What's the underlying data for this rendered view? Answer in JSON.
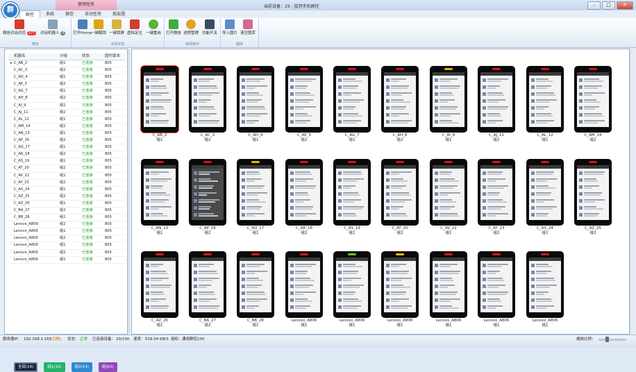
{
  "window": {
    "title": "当前设备：29 - 蓝邦手机群控",
    "context_tab": "营销任务",
    "tabs": [
      "群控",
      "系统",
      "微信",
      "自动任务",
      "朋友圈"
    ],
    "logo_glyph": "群"
  },
  "ribbon": {
    "groups": [
      {
        "label": "微信",
        "buttons": [
          {
            "label": "微信对话总控",
            "badge": "177"
          },
          {
            "label": "对话机器人",
            "badge": "0"
          }
        ]
      },
      {
        "label": "手机状态",
        "buttons": [
          {
            "label": "打开Home"
          },
          {
            "label": "一键解锁"
          },
          {
            "label": "一键锁屏"
          },
          {
            "label": "虚拟定位"
          },
          {
            "label": "一键重启"
          }
        ]
      },
      {
        "label": "常规操作",
        "buttons": [
          {
            "label": "打开微信"
          },
          {
            "label": "进程管理"
          },
          {
            "label": "功能开关"
          }
        ]
      },
      {
        "label": "图库",
        "buttons": [
          {
            "label": "导入图片"
          },
          {
            "label": "清空图库"
          }
        ]
      }
    ]
  },
  "device_table": {
    "headers": [
      "机器名",
      "分组",
      "状态",
      "固件版本"
    ],
    "rows": [
      {
        "name": "C_AB_2",
        "group": "组1",
        "status": "已连接",
        "fw": "805"
      },
      {
        "name": "C_AC_3",
        "group": "组2",
        "status": "已连接",
        "fw": "805"
      },
      {
        "name": "C_AD_4",
        "group": "组1",
        "status": "已连接",
        "fw": "805"
      },
      {
        "name": "C_AE_5",
        "group": "组2",
        "status": "已连接",
        "fw": "805"
      },
      {
        "name": "C_AG_7",
        "group": "组1",
        "status": "已连接",
        "fw": "805"
      },
      {
        "name": "C_AH_8",
        "group": "组2",
        "status": "已连接",
        "fw": "805"
      },
      {
        "name": "C_AI_9",
        "group": "组1",
        "status": "已连接",
        "fw": "805"
      },
      {
        "name": "C_AJ_11",
        "group": "组2",
        "status": "已连接",
        "fw": "805"
      },
      {
        "name": "C_AL_12",
        "group": "组1",
        "status": "已连接",
        "fw": "805"
      },
      {
        "name": "C_AM_14",
        "group": "组2",
        "status": "已连接",
        "fw": "805"
      },
      {
        "name": "C_AN_13",
        "group": "组1",
        "status": "已连接",
        "fw": "805"
      },
      {
        "name": "C_AP_16",
        "group": "组2",
        "status": "已连接",
        "fw": "805"
      },
      {
        "name": "C_AQ_17",
        "group": "组1",
        "status": "已连接",
        "fw": "805"
      },
      {
        "name": "C_AR_18",
        "group": "组2",
        "status": "已连接",
        "fw": "805"
      },
      {
        "name": "C_AS_19",
        "group": "组1",
        "status": "已连接",
        "fw": "805"
      },
      {
        "name": "C_AT_20",
        "group": "组2",
        "status": "已连接",
        "fw": "805"
      },
      {
        "name": "C_AV_22",
        "group": "组1",
        "status": "已连接",
        "fw": "805"
      },
      {
        "name": "C_AY_23",
        "group": "组2",
        "status": "已连接",
        "fw": "805"
      },
      {
        "name": "C_AX_24",
        "group": "组1",
        "status": "已连接",
        "fw": "805"
      },
      {
        "name": "C_AZ_25",
        "group": "组2",
        "status": "已连接",
        "fw": "805"
      },
      {
        "name": "C_AZ_26",
        "group": "组1",
        "status": "已连接",
        "fw": "805"
      },
      {
        "name": "C_BA_27",
        "group": "组2",
        "status": "已连接",
        "fw": "805"
      },
      {
        "name": "C_BB_28",
        "group": "组1",
        "status": "已连接",
        "fw": "805"
      },
      {
        "name": "Lenovo_A806",
        "group": "组2",
        "status": "已连接",
        "fw": "805"
      },
      {
        "name": "Lenovo_A806",
        "group": "组1",
        "status": "已连接",
        "fw": "805"
      },
      {
        "name": "Lenovo_A806",
        "group": "组2",
        "status": "已连接",
        "fw": "805"
      },
      {
        "name": "Lenovo_A806",
        "group": "组1",
        "status": "已连接",
        "fw": "805"
      },
      {
        "name": "Lenovo_A806",
        "group": "组2",
        "status": "已连接",
        "fw": "805"
      },
      {
        "name": "Lenovo_A806",
        "group": "组1",
        "status": "已连接",
        "fw": "805"
      }
    ]
  },
  "group_buttons": [
    {
      "label": "全部(29)"
    },
    {
      "label": "组1(15)"
    },
    {
      "label": "组2(14)"
    },
    {
      "label": "组3(0)"
    }
  ],
  "phones": [
    {
      "name": "C_AB_2",
      "group": "组1",
      "selected": true
    },
    {
      "name": "C_AC_3",
      "group": "组2"
    },
    {
      "name": "C_AD_4",
      "group": "组1"
    },
    {
      "name": "C_AE_5",
      "group": "组2"
    },
    {
      "name": "C_AG_7",
      "group": "组1"
    },
    {
      "name": "C_AH_8",
      "group": "组2"
    },
    {
      "name": "C_AI_9",
      "group": "组1",
      "led": "yellow"
    },
    {
      "name": "C_AJ_11",
      "group": "组2"
    },
    {
      "name": "C_AL_12",
      "group": "组1"
    },
    {
      "name": "C_AM_14",
      "group": "组2"
    },
    {
      "name": "C_AN_13",
      "group": "组1"
    },
    {
      "name": "C_AP_16",
      "group": "组2",
      "dark": true
    },
    {
      "name": "C_AQ_17",
      "group": "组1",
      "led": "yellow"
    },
    {
      "name": "C_AR_18",
      "group": "组2"
    },
    {
      "name": "C_AS_19",
      "group": "组1"
    },
    {
      "name": "C_AT_20",
      "group": "组2"
    },
    {
      "name": "C_AV_22",
      "group": "组1"
    },
    {
      "name": "C_AY_23",
      "group": "组2"
    },
    {
      "name": "C_AX_24",
      "group": "组1"
    },
    {
      "name": "C_AZ_25",
      "group": "组2"
    },
    {
      "name": "C_AZ_26",
      "group": "组1"
    },
    {
      "name": "C_BA_27",
      "group": "组2"
    },
    {
      "name": "C_BB_28",
      "group": "组1"
    },
    {
      "name": "Lenovo_A806",
      "group": "组1"
    },
    {
      "name": "Lenovo_A806",
      "group": "组1",
      "led": "green"
    },
    {
      "name": "Lenovo_A806",
      "group": "组1",
      "led": "yellow"
    },
    {
      "name": "Lenovo_A806",
      "group": "组1"
    },
    {
      "name": "Lenovo_A806",
      "group": "组1"
    },
    {
      "name": "Lenovo_A806",
      "group": "组1"
    }
  ],
  "statusbar": {
    "server_ip_label": "服务器IP：",
    "server_ip": "192.168.1.165",
    "ip_switch": "[切换]",
    "state_label": "状态：",
    "state": "正常",
    "connected_label": "已连接设备：",
    "connected": "29/100",
    "speed_label": "速率：",
    "speed": "518.04 KB/S",
    "license_label": "授权：",
    "license": "通用群控100",
    "zoom_label": "缩放比例："
  },
  "colors": {
    "connected": "#19a21f",
    "group1": "#25b36b",
    "group2": "#2f8ad2",
    "group3": "#8e4cb8",
    "selected_outline": "#e3522e"
  }
}
